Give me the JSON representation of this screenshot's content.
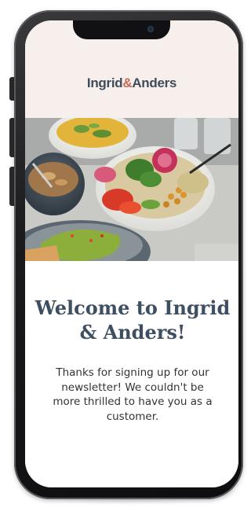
{
  "brand": {
    "name_part1": "Ingrid",
    "ampersand": "&",
    "name_part2": "Anders",
    "accent_color": "#c86a52",
    "text_color": "#3e4c5a"
  },
  "hero": {
    "icon": "food-bowls-photo"
  },
  "content": {
    "headline": "Welcome to Ingrid & Anders!",
    "body": "Thanks for signing up for our newsletter! We couldn't be more thrilled to have you as a customer."
  },
  "colors": {
    "header_bg": "#f6efec",
    "headline": "#3e4f62"
  }
}
